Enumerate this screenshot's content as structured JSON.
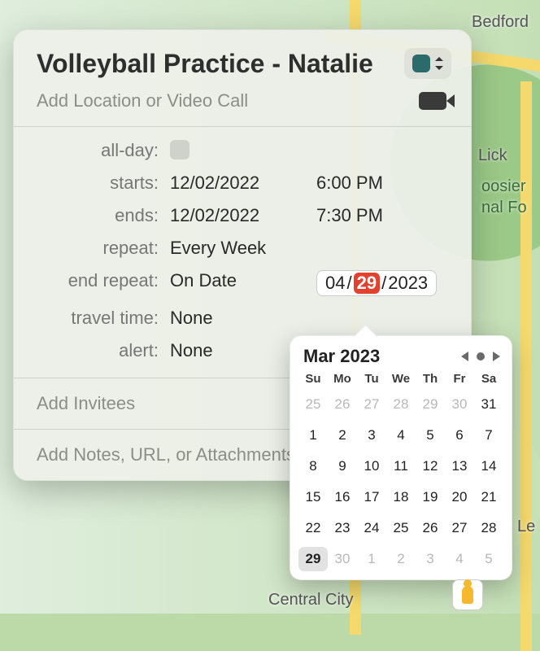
{
  "map": {
    "labels": {
      "bedford": "Bedford",
      "lick": "Lick",
      "hoosier1": "oosier",
      "hoosier2": "nal Fo",
      "le": "Le",
      "central": "Central City"
    }
  },
  "event": {
    "title": "Volleyball Practice - Natalie",
    "location_placeholder": "Add Location or Video Call",
    "labels": {
      "allday": "all-day:",
      "starts": "starts:",
      "ends": "ends:",
      "repeat": "repeat:",
      "end_repeat": "end repeat:",
      "travel": "travel time:",
      "alert": "alert:"
    },
    "start_date": "12/02/2022",
    "start_time": "6:00 PM",
    "end_date": "12/02/2022",
    "end_time": "7:30 PM",
    "repeat_value": "Every Week",
    "end_repeat_mode": "On Date",
    "end_repeat_date": {
      "mm": "04",
      "dd": "29",
      "yyyy": "2023"
    },
    "travel_value": "None",
    "alert_value": "None",
    "invitees_placeholder": "Add Invitees",
    "notes_placeholder": "Add Notes, URL, or Attachments"
  },
  "minical": {
    "title": "Mar 2023",
    "dow": [
      "Su",
      "Mo",
      "Tu",
      "We",
      "Th",
      "Fr",
      "Sa"
    ],
    "weeks": [
      [
        {
          "n": "25",
          "out": true
        },
        {
          "n": "26",
          "out": true
        },
        {
          "n": "27",
          "out": true
        },
        {
          "n": "28",
          "out": true
        },
        {
          "n": "29",
          "out": true
        },
        {
          "n": "30",
          "out": true
        },
        {
          "n": "31"
        }
      ],
      [
        {
          "n": "1"
        },
        {
          "n": "2"
        },
        {
          "n": "3"
        },
        {
          "n": "4"
        },
        {
          "n": "5"
        },
        {
          "n": "6"
        },
        {
          "n": "7"
        }
      ],
      [
        {
          "n": "8"
        },
        {
          "n": "9"
        },
        {
          "n": "10"
        },
        {
          "n": "11"
        },
        {
          "n": "12"
        },
        {
          "n": "13"
        },
        {
          "n": "14"
        }
      ],
      [
        {
          "n": "15"
        },
        {
          "n": "16"
        },
        {
          "n": "17"
        },
        {
          "n": "18"
        },
        {
          "n": "19"
        },
        {
          "n": "20"
        },
        {
          "n": "21"
        }
      ],
      [
        {
          "n": "22"
        },
        {
          "n": "23"
        },
        {
          "n": "24"
        },
        {
          "n": "25"
        },
        {
          "n": "26"
        },
        {
          "n": "27"
        },
        {
          "n": "28"
        }
      ],
      [
        {
          "n": "29",
          "sel": true
        },
        {
          "n": "30",
          "out": true
        },
        {
          "n": "1",
          "out": true
        },
        {
          "n": "2",
          "out": true
        },
        {
          "n": "3",
          "out": true
        },
        {
          "n": "4",
          "out": true
        },
        {
          "n": "5",
          "out": true
        }
      ]
    ]
  }
}
